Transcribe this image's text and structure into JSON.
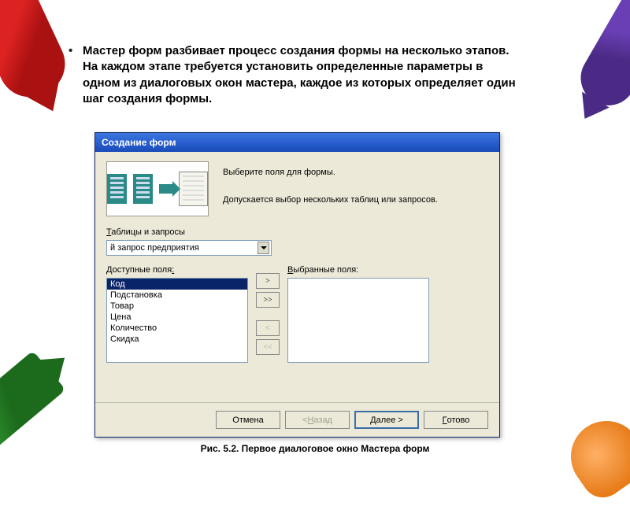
{
  "bullet_text": "Мастер форм разбивает процесс создания формы на несколько этапов. На каждом этапе требуется установить определенные параметры в одном из диалоговых окон мастера, каждое из которых определяет один шаг создания формы.",
  "caption": "Рис. 5.2. Первое диалоговое окно Мастера форм",
  "dialog": {
    "title": "Создание форм",
    "instr1": "Выберите поля для формы.",
    "instr2": "Допускается выбор нескольких таблиц или запросов.",
    "tables_label": "Таблицы и запросы",
    "tables_value": "й запрос предприятия",
    "available_label": "Доступные поля:",
    "selected_label": "Выбранные поля:",
    "available": [
      "Код",
      "Подстановка",
      "Товар",
      "Цена",
      "Количество",
      "Скидка"
    ],
    "move": {
      "one": ">",
      "all": ">>",
      "back": "<",
      "backall": "<<"
    },
    "buttons": {
      "cancel": "Отмена",
      "back": "< Назад",
      "next": "Далее >",
      "finish": "Готово"
    }
  }
}
